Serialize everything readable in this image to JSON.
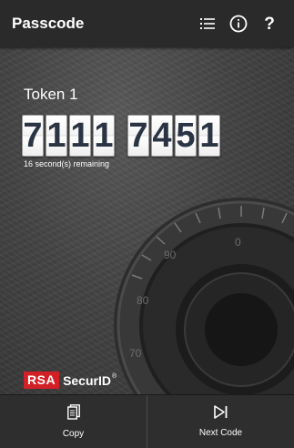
{
  "appbar": {
    "title": "Passcode",
    "actions": [
      {
        "icon": "token-list-icon"
      },
      {
        "icon": "info-icon"
      },
      {
        "icon": "help-icon",
        "glyph": "?"
      }
    ]
  },
  "token": {
    "name": "Token 1",
    "code_groups": [
      [
        "7",
        "1",
        "1",
        "1"
      ],
      [
        "7",
        "4",
        "5",
        "1"
      ]
    ],
    "remaining": "16 second(s) remaining"
  },
  "brand": {
    "rsa": "RSA",
    "securid": "SecurID",
    "trademark": "®",
    "rsa_color": "#d31f26"
  },
  "background": {
    "dial_marks": [
      "90",
      "0",
      "80",
      "70"
    ]
  },
  "bottom": {
    "copy_label": "Copy",
    "next_label": "Next Code"
  }
}
